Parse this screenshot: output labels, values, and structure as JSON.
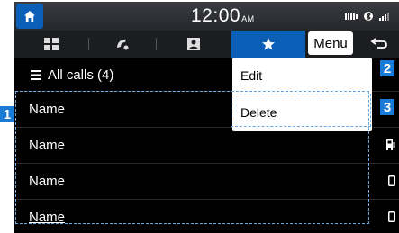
{
  "status_bar": {
    "time": "12:00",
    "ampm": "AM"
  },
  "tabs": [
    {
      "icon": "keypad-icon"
    },
    {
      "icon": "recent-calls-icon"
    },
    {
      "icon": "contacts-icon"
    },
    {
      "icon": "favorites-star-icon"
    }
  ],
  "header": {
    "menu_label": "Menu"
  },
  "list_header": {
    "label": "All calls (4)"
  },
  "rows": [
    {
      "name": "Name"
    },
    {
      "name": "Name",
      "device": "car-phone-icon"
    },
    {
      "name": "Name",
      "device": "mobile-phone-icon"
    },
    {
      "name": "Name",
      "device": "mobile-phone-icon"
    }
  ],
  "popup_menu": {
    "items": [
      "Edit",
      "Delete"
    ]
  },
  "callouts": [
    "1",
    "2",
    "3"
  ],
  "colors": {
    "accent": "#0b5fb6",
    "callout": "#1a7bd6",
    "dotted_outline": "#6aa8e0"
  }
}
